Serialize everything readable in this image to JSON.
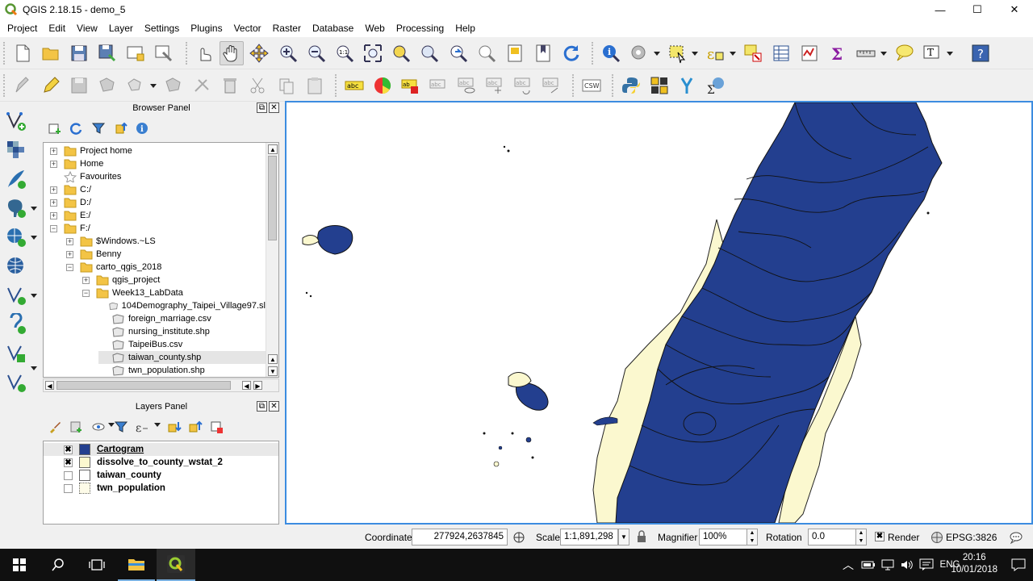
{
  "window": {
    "title": "QGIS 2.18.15 - demo_5",
    "min": "—",
    "max": "☐",
    "close": "✕"
  },
  "menu": [
    "Project",
    "Edit",
    "View",
    "Layer",
    "Settings",
    "Plugins",
    "Vector",
    "Raster",
    "Database",
    "Web",
    "Processing",
    "Help"
  ],
  "browser_panel": {
    "title": "Browser Panel",
    "tree": [
      {
        "label": "Project home",
        "icon": "folder-icon",
        "expand": "+"
      },
      {
        "label": "Home",
        "icon": "folder-icon",
        "expand": "+"
      },
      {
        "label": "Favourites",
        "icon": "star-icon",
        "expand": ""
      },
      {
        "label": "C:/",
        "icon": "folder-icon",
        "expand": "+"
      },
      {
        "label": "D:/",
        "icon": "folder-icon",
        "expand": "+"
      },
      {
        "label": "E:/",
        "icon": "folder-icon",
        "expand": "+"
      },
      {
        "label": "F:/",
        "icon": "folder-icon",
        "expand": "−"
      },
      {
        "label": "$Windows.~LS",
        "icon": "folder-icon",
        "expand": "+"
      },
      {
        "label": "Benny",
        "icon": "folder-icon",
        "expand": "+"
      },
      {
        "label": "carto_qgis_2018",
        "icon": "folder-icon",
        "expand": "−"
      },
      {
        "label": "qgis_project",
        "icon": "folder-icon",
        "expand": "+"
      },
      {
        "label": "Week13_LabData",
        "icon": "folder-icon",
        "expand": "−"
      },
      {
        "label": "104Demography_Taipei_Village97.sl",
        "icon": "polygon-layer-icon",
        "expand": ""
      },
      {
        "label": "foreign_marriage.csv",
        "icon": "polygon-layer-icon",
        "expand": ""
      },
      {
        "label": "nursing_institute.shp",
        "icon": "polygon-layer-icon",
        "expand": ""
      },
      {
        "label": "TaipeiBus.csv",
        "icon": "polygon-layer-icon",
        "expand": ""
      },
      {
        "label": "taiwan_county.shp",
        "icon": "polygon-layer-icon",
        "expand": ""
      },
      {
        "label": "twn_population.shp",
        "icon": "polygon-layer-icon",
        "expand": ""
      }
    ]
  },
  "layers_panel": {
    "title": "Layers Panel",
    "layers": [
      {
        "name": "Cartogram",
        "checked": "✖",
        "fill": "#233f8f"
      },
      {
        "name": "dissolve_to_county_wstat_2",
        "checked": "✖",
        "fill": "#fbf8cf"
      },
      {
        "name": "taiwan_county",
        "checked": "",
        "fill": "#ffffff"
      },
      {
        "name": "twn_population",
        "checked": "",
        "fill": "#fdfbe8"
      }
    ]
  },
  "status": {
    "coordinate_label": "Coordinate",
    "coordinate_value": "277924,2637845",
    "scale_label": "Scale",
    "scale_value": "1:1,891,298",
    "magnifier_label": "Magnifier",
    "magnifier_value": "100%",
    "rotation_label": "Rotation",
    "rotation_value": "0.0",
    "render_label": "Render",
    "render_checked": "✖",
    "crs": "EPSG:3826"
  },
  "taskbar": {
    "lang": "ENG",
    "time": "20:16",
    "date": "10/01/2018"
  },
  "colors": {
    "map_fill": "#233f8f",
    "base_fill": "#fbf8cf",
    "canvas_border": "#3c8ce0"
  }
}
